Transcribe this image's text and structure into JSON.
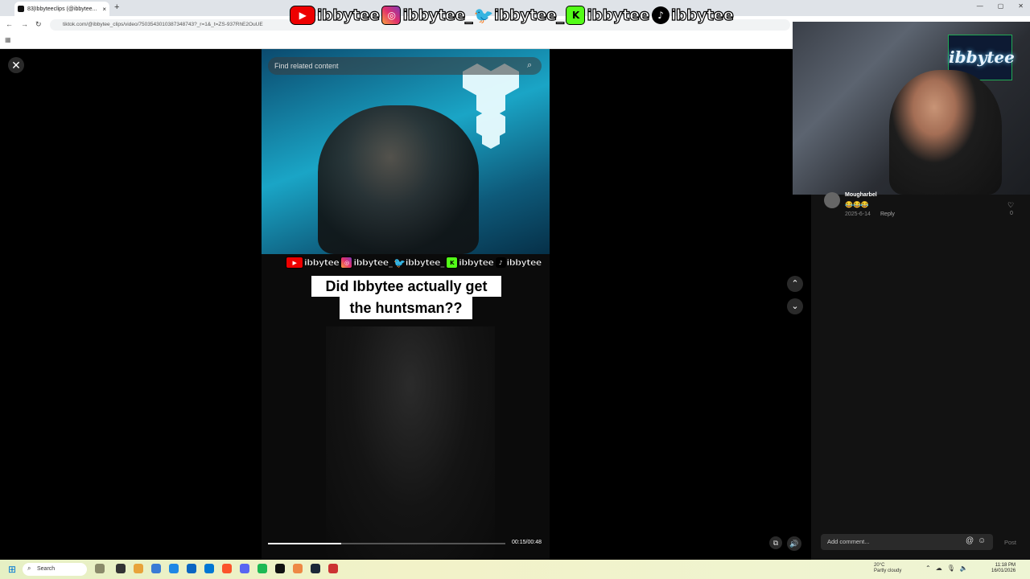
{
  "browser": {
    "tab_title": "83|Ibbyteeclips (@ibbytee...",
    "tab_close": "×",
    "new_tab": "+",
    "url": "tiktok.com/@ibbytee_clips/video/7503543010387348743?_r=1&_t=ZS-937RhE2OuUE",
    "window_controls": [
      "—",
      "▢",
      "✕"
    ]
  },
  "banner": {
    "socials": [
      {
        "name": "youtube",
        "icon": "▶",
        "handle": "ibbytee"
      },
      {
        "name": "instagram",
        "icon": "◎",
        "handle": "ibbytee_"
      },
      {
        "name": "twitter",
        "icon": "🐦",
        "handle": "ibbytee_"
      },
      {
        "name": "kick",
        "icon": "K",
        "handle": "ibbytee"
      },
      {
        "name": "tiktok",
        "icon": "♪",
        "handle": "ibbytee"
      }
    ]
  },
  "video": {
    "search_placeholder": "Find related content",
    "caption_line1": "Did Ibbytee actually get",
    "caption_line2": "the huntsman??",
    "progress": 0.31,
    "time": "00:15/00:48"
  },
  "controls": {
    "close": "✕",
    "up": "⌃",
    "down": "⌄",
    "clip": "⧉",
    "volume": "🔊"
  },
  "comment": {
    "user": "Mougharbel",
    "emoji": "😂😂😂",
    "date": "2025-6-14",
    "reply": "Reply",
    "likes": "0",
    "heart": "♡",
    "add_placeholder": "Add comment...",
    "at": "@",
    "smile": "☺",
    "post": "Post"
  },
  "webcam": {
    "neon_sign": "ibbytee"
  },
  "taskbar": {
    "search_label": "Search",
    "weather_temp": "20°C",
    "weather_desc": "Partly cloudy",
    "time": "11:18 PM",
    "date": "16/01/2026"
  },
  "colors": {
    "accent_red": "#ee0000",
    "kick_green": "#53fc18",
    "twitter_blue": "#1da1f2"
  }
}
